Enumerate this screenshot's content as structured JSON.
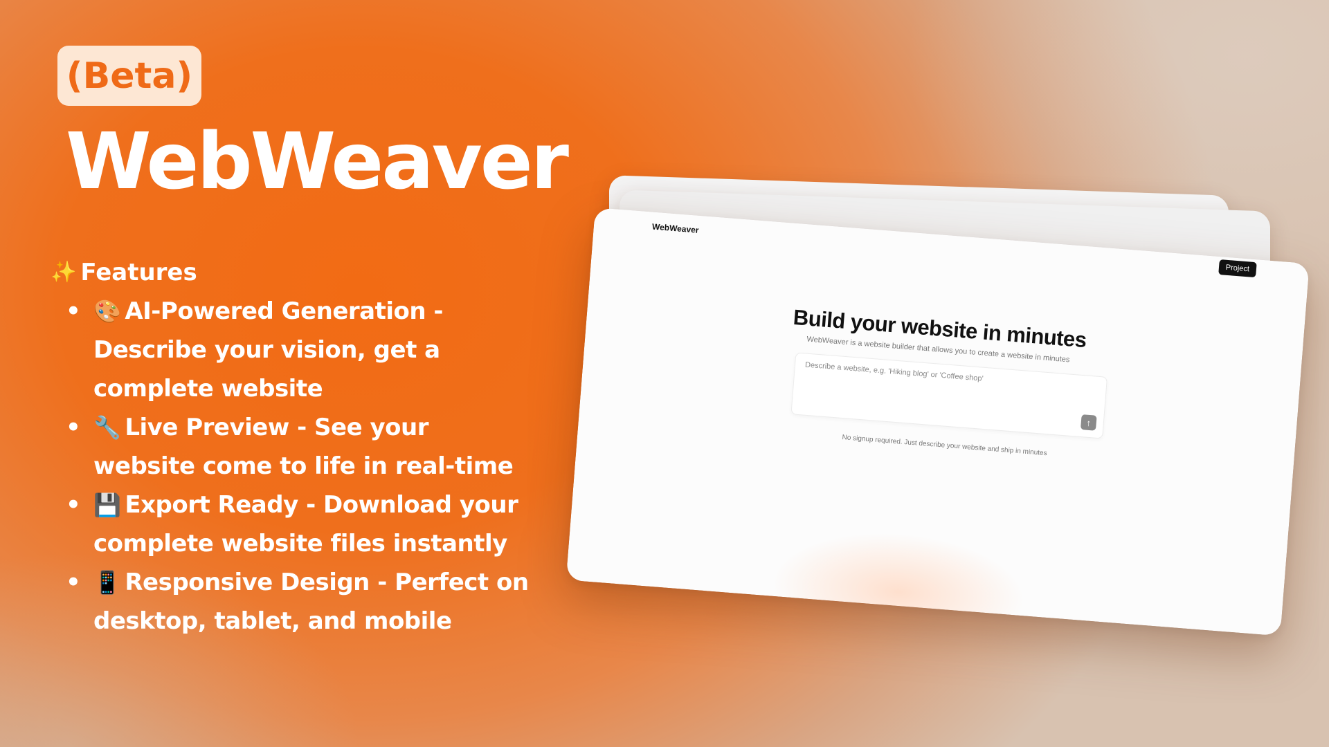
{
  "badge": "(Beta)",
  "app_title": "WebWeaver",
  "features": {
    "heading_icon": "sparkles-icon",
    "heading": "Features",
    "items": [
      {
        "icon": "palette-icon",
        "glyph": "🎨",
        "text": "AI-Powered Generation - Describe your vision, get a complete website"
      },
      {
        "icon": "wrench-icon",
        "glyph": "🔧",
        "text": "Live Preview - See your website come to life in real-time"
      },
      {
        "icon": "floppy-disk-icon",
        "glyph": "💾",
        "text": "Export Ready - Download your complete website files instantly"
      },
      {
        "icon": "mobile-phone-icon",
        "glyph": "📱",
        "text": "Responsive Design - Perfect on desktop, tablet, and mobile"
      }
    ]
  },
  "mockup": {
    "logo": "WebWeaver",
    "project_button": "Project",
    "hero_title": "Build your website in minutes",
    "hero_subtitle": "WebWeaver is a website builder that allows you to create a website in minutes",
    "prompt_placeholder": "Describe a website, e.g. 'Hiking blog' or 'Coffee shop'",
    "send_icon": "arrow-up-icon",
    "footnote": "No signup required. Just describe your website and ship in minutes"
  },
  "colors": {
    "brand_orange": "#f26b14",
    "badge_bg": "#fde7d4",
    "text_white": "#ffffff"
  }
}
